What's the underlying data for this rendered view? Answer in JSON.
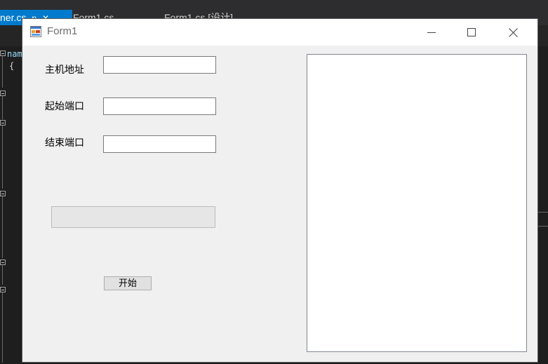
{
  "ide": {
    "tabs": [
      {
        "label": "ner.cs",
        "active": true,
        "pin": "ᵽ",
        "close": "✕"
      },
      {
        "label": "Form1.cs",
        "active": false
      },
      {
        "label": "Form1.cs [设计]",
        "active": false
      }
    ],
    "code_fragment": "nam",
    "brace": "{"
  },
  "window": {
    "title": "Form1",
    "minimize": "minimize",
    "maximize": "maximize",
    "close": "close"
  },
  "form": {
    "host_label": "主机地址",
    "host_value": "",
    "start_port_label": "起始端口",
    "start_port_value": "",
    "end_port_label": "结束端口",
    "end_port_value": "",
    "progress_percent": 0,
    "start_button": "开始",
    "output": ""
  },
  "colors": {
    "accent": "#007acc",
    "form_bg": "#f0f0f0",
    "ide_bg": "#1e1e1e"
  }
}
